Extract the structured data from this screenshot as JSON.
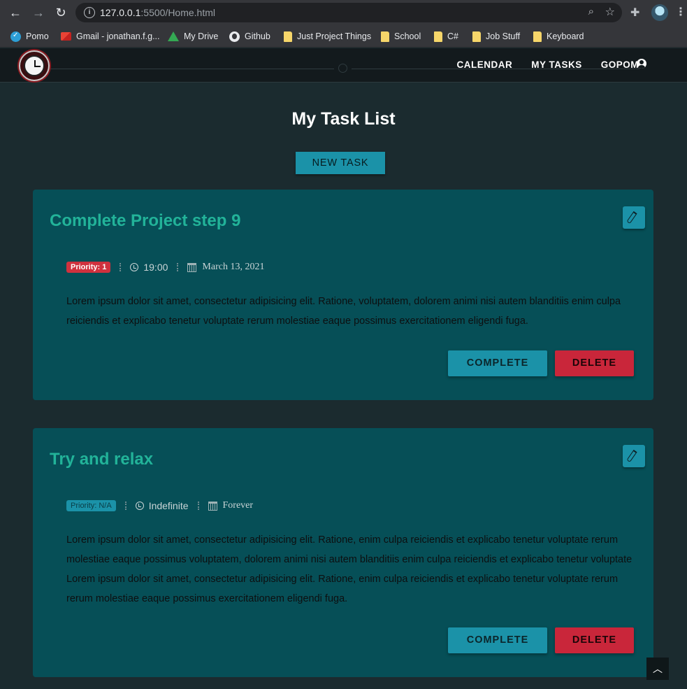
{
  "browser": {
    "url_host": "127.0.0.1",
    "url_port_path": ":5500/Home.html",
    "bookmarks": [
      "Pomo",
      "Gmail - jonathan.f.g...",
      "My Drive",
      "Github",
      "Just Project Things",
      "School",
      "C#",
      "Job Stuff",
      "Keyboard"
    ]
  },
  "navbar": {
    "links": [
      "CALENDAR",
      "MY TASKS",
      "GOPOMO"
    ]
  },
  "page": {
    "title": "My Task List",
    "new_task_label": "NEW TASK"
  },
  "tasks": [
    {
      "title": "Complete Project step 9",
      "priority": "Priority: 1",
      "time": "19:00",
      "date": "March 13, 2021",
      "description": "Lorem ipsum dolor sit amet, consectetur adipisicing elit. Ratione, voluptatem, dolorem animi nisi autem blanditiis enim culpa reiciendis et explicabo tenetur voluptate rerum molestiae eaque possimus exercitationem eligendi fuga.",
      "complete_label": "COMPLETE",
      "delete_label": "DELETE"
    },
    {
      "title": "Try and relax",
      "priority": "Priority: N/A",
      "time": "Indefinite",
      "date": "Forever",
      "description": "Lorem ipsum dolor sit amet, consectetur adipisicing elit. Ratione, enim culpa reiciendis et explicabo tenetur voluptate rerum molestiae eaque possimus voluptatem, dolorem animi nisi autem blanditiis enim culpa reiciendis et explicabo tenetur voluptate Lorem ipsum dolor sit amet, consectetur adipisicing elit. Ratione, enim culpa reiciendis et explicabo tenetur voluptate rerum rerum molestiae eaque possimus exercitationem eligendi fuga.",
      "complete_label": "COMPLETE",
      "delete_label": "DELETE"
    }
  ],
  "colors": {
    "page_bg": "#1b2b2f",
    "card_bg": "#064f57",
    "accent": "#1b92a8",
    "title_green": "#22b399",
    "danger": "#c9263a"
  }
}
